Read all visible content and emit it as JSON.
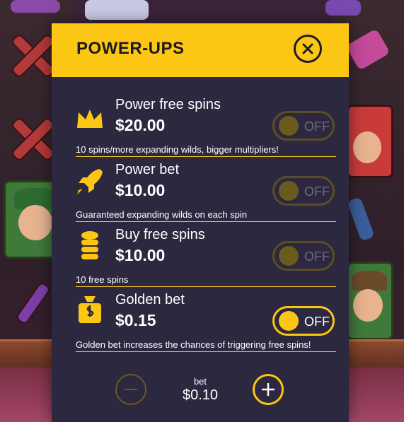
{
  "modal": {
    "title": "POWER-UPS"
  },
  "powerups": [
    {
      "icon": "crown-icon",
      "name": "Power free spins",
      "price": "$20.00",
      "description": "10 spins/more expanding wilds, bigger multipliers!",
      "toggle_label": "OFF",
      "active": false
    },
    {
      "icon": "rocket-icon",
      "name": "Power bet",
      "price": "$10.00",
      "description": "Guaranteed expanding wilds on each spin",
      "toggle_label": "OFF",
      "active": false
    },
    {
      "icon": "coin-stack-icon",
      "name": "Buy free spins",
      "price": "$10.00",
      "description": "10 free spins",
      "toggle_label": "OFF",
      "active": false
    },
    {
      "icon": "money-bag-icon",
      "name": "Golden bet",
      "price": "$0.15",
      "description": "Golden bet increases the chances of triggering free spins!",
      "toggle_label": "OFF",
      "active": true
    }
  ],
  "bet": {
    "label": "bet",
    "value": "$0.10"
  },
  "colors": {
    "accent": "#fcc714",
    "panel": "#2c2840",
    "text": "#ffffff",
    "inactive_toggle": "#6a5a1c"
  }
}
